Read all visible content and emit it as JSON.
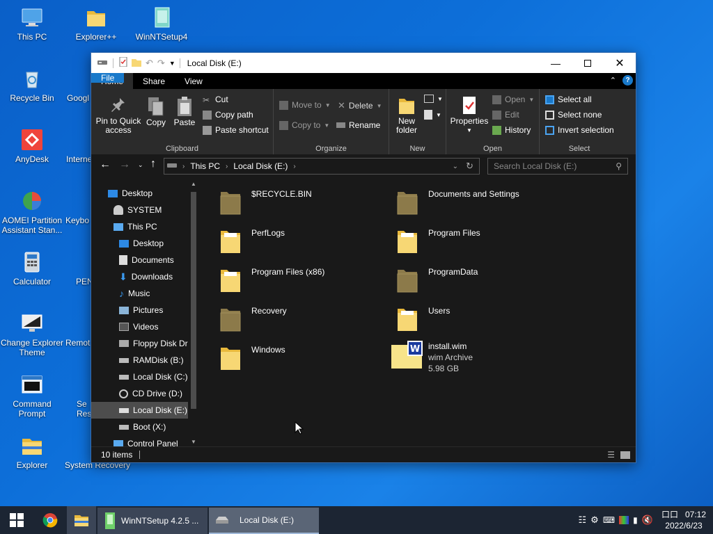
{
  "desktop": {
    "icons": [
      {
        "label": "This PC"
      },
      {
        "label": "Explorer++"
      },
      {
        "label": "WinNTSetup4"
      },
      {
        "label": "Recycle Bin"
      },
      {
        "label": "Googl"
      },
      {
        "label": "AnyDesk"
      },
      {
        "label": "Interne"
      },
      {
        "label": "AOMEI Partition Assistant Stan..."
      },
      {
        "label": "Keybo"
      },
      {
        "label": "Calculator"
      },
      {
        "label": "PEN"
      },
      {
        "label": "Change Explorer Theme"
      },
      {
        "label": "Remot"
      },
      {
        "label": "Command Prompt"
      },
      {
        "label": "Se Resc"
      },
      {
        "label": "Explorer"
      },
      {
        "label": "System Recovery"
      }
    ]
  },
  "window": {
    "title": "Local Disk (E:)",
    "tabs": [
      "File",
      "Home",
      "Share",
      "View"
    ],
    "ribbon": {
      "clipboard": {
        "pin": "Pin to Quick access",
        "copy": "Copy",
        "paste": "Paste",
        "cut": "Cut",
        "copy_path": "Copy path",
        "paste_shortcut": "Paste shortcut",
        "label": "Clipboard"
      },
      "organize": {
        "move_to": "Move to",
        "copy_to": "Copy to",
        "delete": "Delete",
        "rename": "Rename",
        "label": "Organize"
      },
      "new": {
        "new_folder": "New folder",
        "label": "New"
      },
      "open": {
        "properties": "Properties",
        "open": "Open",
        "edit": "Edit",
        "history": "History",
        "label": "Open"
      },
      "select": {
        "select_all": "Select all",
        "select_none": "Select none",
        "invert": "Invert selection",
        "label": "Select"
      }
    },
    "address": {
      "crumbs": [
        "This PC",
        "Local Disk (E:)"
      ],
      "search_placeholder": "Search Local Disk (E:)"
    },
    "nav": [
      {
        "label": "Desktop"
      },
      {
        "label": "SYSTEM"
      },
      {
        "label": "This PC"
      },
      {
        "label": "Desktop"
      },
      {
        "label": "Documents"
      },
      {
        "label": "Downloads"
      },
      {
        "label": "Music"
      },
      {
        "label": "Pictures"
      },
      {
        "label": "Videos"
      },
      {
        "label": "Floppy Disk Dri"
      },
      {
        "label": "RAMDisk (B:)"
      },
      {
        "label": "Local Disk (C:)"
      },
      {
        "label": "CD Drive (D:)"
      },
      {
        "label": "Local Disk (E:)"
      },
      {
        "label": "Boot (X:)"
      },
      {
        "label": "Control Panel"
      }
    ],
    "files": [
      {
        "name": "$RECYCLE.BIN"
      },
      {
        "name": "Documents and Settings"
      },
      {
        "name": "PerfLogs"
      },
      {
        "name": "Program Files"
      },
      {
        "name": "Program Files (x86)"
      },
      {
        "name": "ProgramData"
      },
      {
        "name": "Recovery"
      },
      {
        "name": "Users"
      },
      {
        "name": "Windows"
      },
      {
        "name": "install.wim",
        "type": "wim Archive",
        "size": "5.98 GB"
      }
    ],
    "status": "10 items"
  },
  "taskbar": {
    "apps": [
      {
        "label": "WinNTSetup 4.2.5 ..."
      },
      {
        "label": "Local Disk (E:)"
      }
    ],
    "clock_time": "   07:12",
    "clock_prefix": "口口",
    "clock_date": "2022/6/23"
  },
  "colors": {
    "accent": "#1979ca",
    "folder": "#f7d774",
    "folder_dark": "#8c7a4a",
    "taskbar": "#1c2533"
  }
}
